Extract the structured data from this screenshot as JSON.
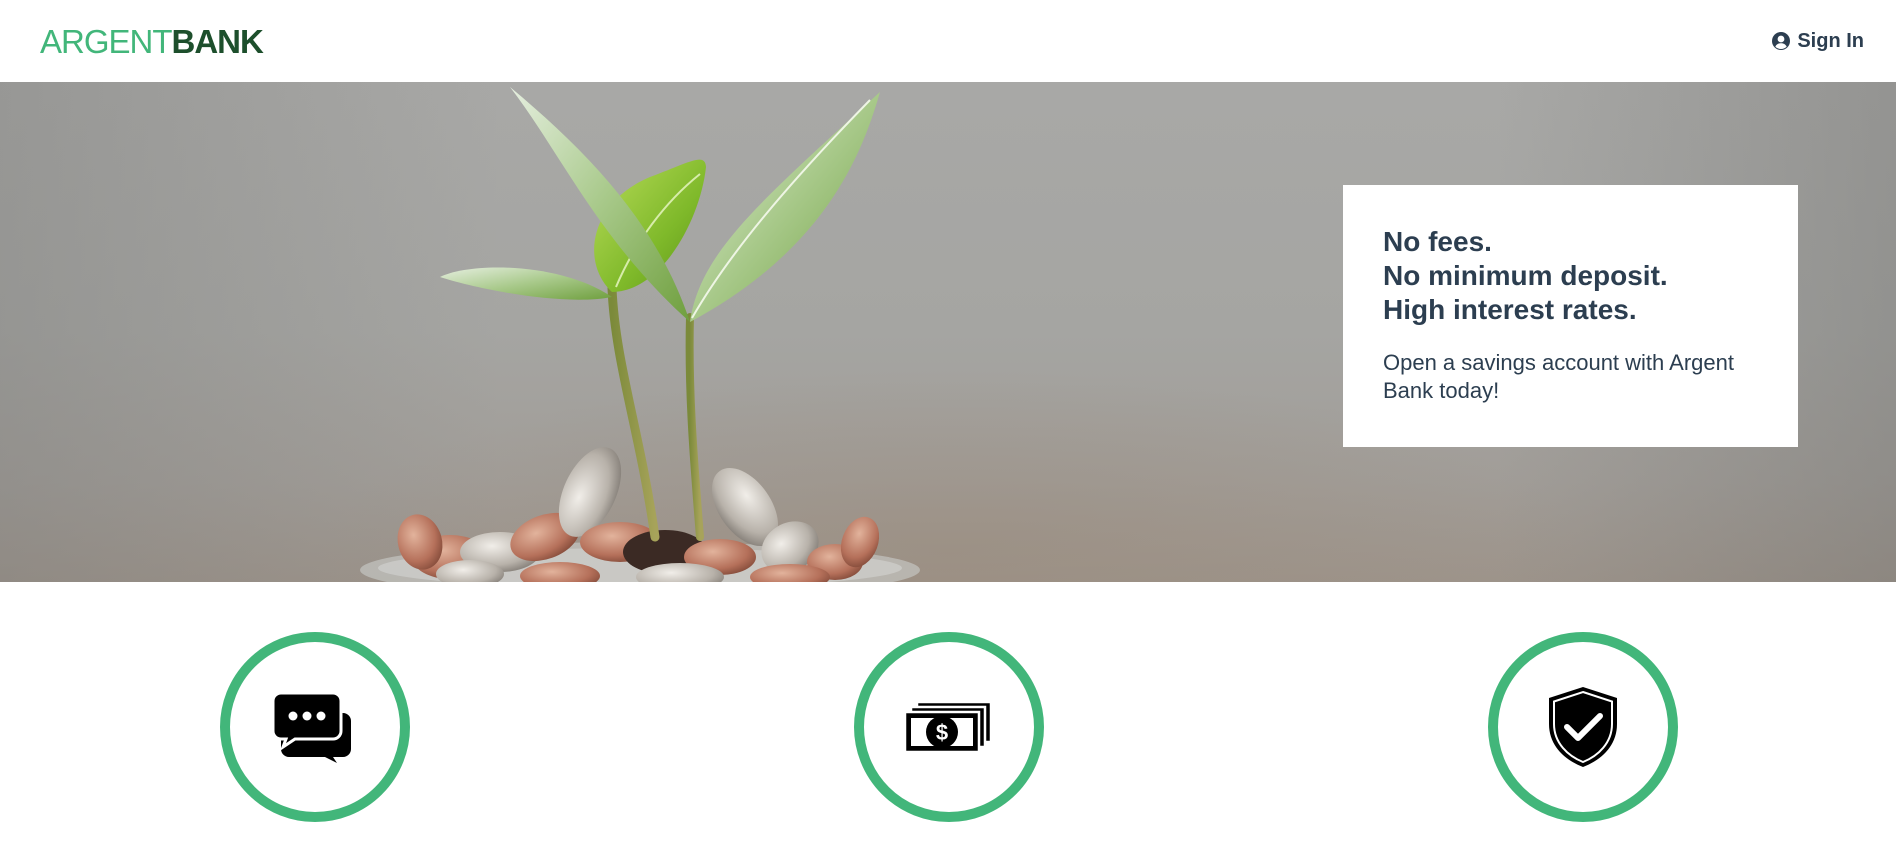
{
  "header": {
    "logo": {
      "part1": "ARGENT",
      "part2": "BANK"
    },
    "sign_in_label": "Sign In"
  },
  "hero": {
    "image": "seedling-growing-from-coins",
    "promo": {
      "subtitles": [
        "No fees.",
        "No minimum deposit.",
        "High interest rates."
      ],
      "text": "Open a savings account with Argent Bank today!"
    }
  },
  "features": [
    {
      "icon": "chat-icon"
    },
    {
      "icon": "money-icon"
    },
    {
      "icon": "security-shield-icon"
    }
  ],
  "colors": {
    "brand_green": "#42b67a",
    "brand_dark_green": "#1d4f2c",
    "text": "#2c3e50"
  }
}
